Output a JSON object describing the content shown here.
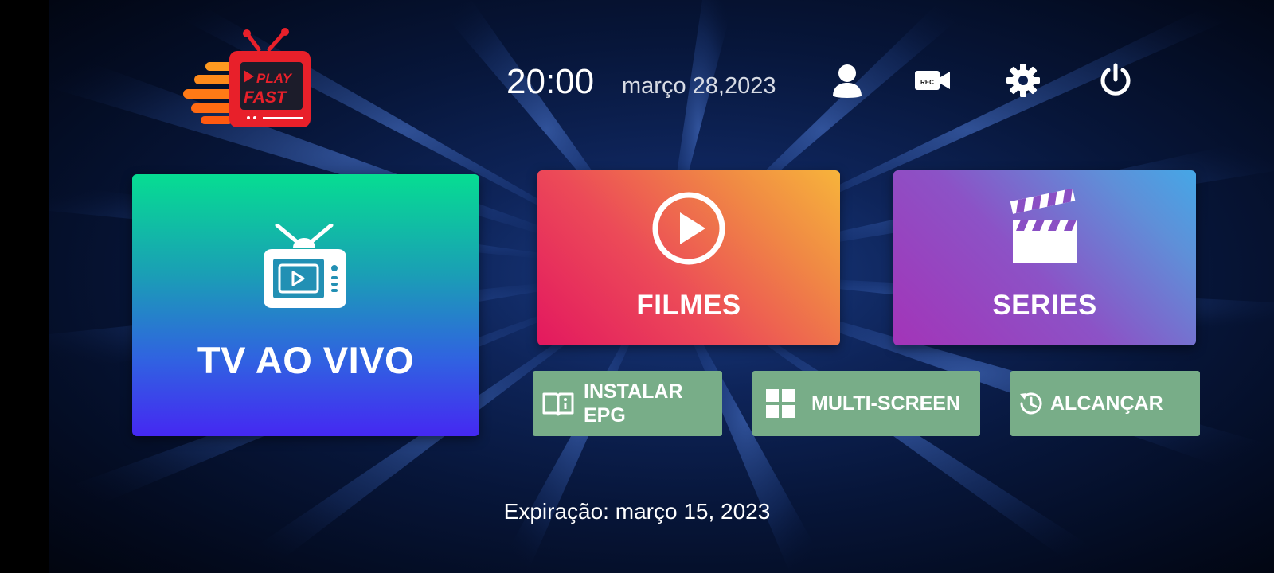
{
  "app": {
    "logo_word_top": "PLAY",
    "logo_word_bottom": "FAST"
  },
  "header": {
    "time": "20:00",
    "date": "março 28,2023",
    "icons": {
      "profile": "user-icon",
      "record": "rec-camera-icon",
      "settings": "gear-icon",
      "power": "power-icon"
    },
    "rec_label": "REC"
  },
  "tiles": {
    "live_tv": {
      "label": "TV AO VIVO",
      "icon": "tv-icon"
    },
    "movies": {
      "label": "FILMES",
      "icon": "play-circle-icon"
    },
    "series": {
      "label": "SERIES",
      "icon": "clapperboard-icon"
    }
  },
  "actions": {
    "epg": {
      "label": "INSTALAR EPG",
      "icon": "book-info-icon"
    },
    "multiscreen": {
      "label": "MULTI-SCREEN",
      "icon": "grid-icon"
    },
    "catchup": {
      "label": "ALCANÇAR",
      "icon": "history-icon"
    }
  },
  "footer": {
    "expiry": "Expiração: março 15, 2023"
  },
  "colors": {
    "background": "#07163a",
    "live_top": "#06dd92",
    "live_bottom": "#4528f2",
    "movies_start": "#e3185f",
    "movies_end": "#f7b43b",
    "series_start": "#a334b8",
    "series_end": "#45a7e6",
    "action_button": "#78ad88",
    "logo_red": "#e8202a",
    "logo_orange": "#ff8a1a"
  }
}
